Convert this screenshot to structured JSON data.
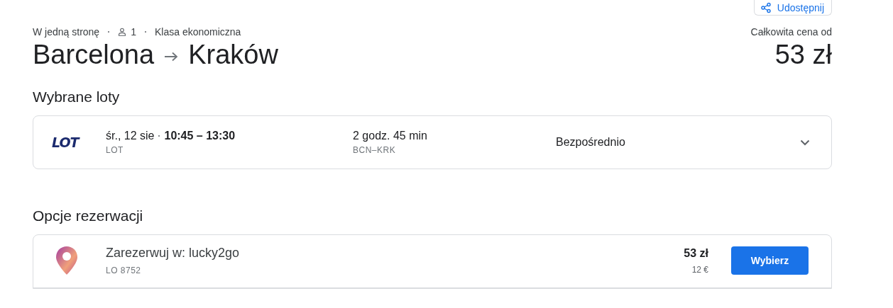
{
  "share_button": {
    "label": "Udostępnij"
  },
  "trip": {
    "type_label": "W jedną stronę",
    "passengers": "1",
    "cabin": "Klasa ekonomiczna",
    "origin": "Barcelona",
    "destination": "Kraków"
  },
  "total": {
    "label": "Całkowita cena od",
    "price": "53 zł"
  },
  "selected_flights": {
    "heading": "Wybrane loty",
    "flights": [
      {
        "airline_logo": "LOT",
        "date": "śr., 12 sie",
        "times": "10:45 – 13:30",
        "airline": "LOT",
        "duration": "2 godz. 45 min",
        "route": "BCN–KRK",
        "stops": "Bezpośrednio",
        "expanded": false
      }
    ]
  },
  "booking_options": {
    "heading": "Opcje rezerwacji",
    "options": [
      {
        "title": "Zarezerwuj w: lucky2go",
        "flight_number": "LO 8752",
        "price": "53 zł",
        "price_alt": "12 €",
        "button": "Wybierz"
      }
    ]
  }
}
